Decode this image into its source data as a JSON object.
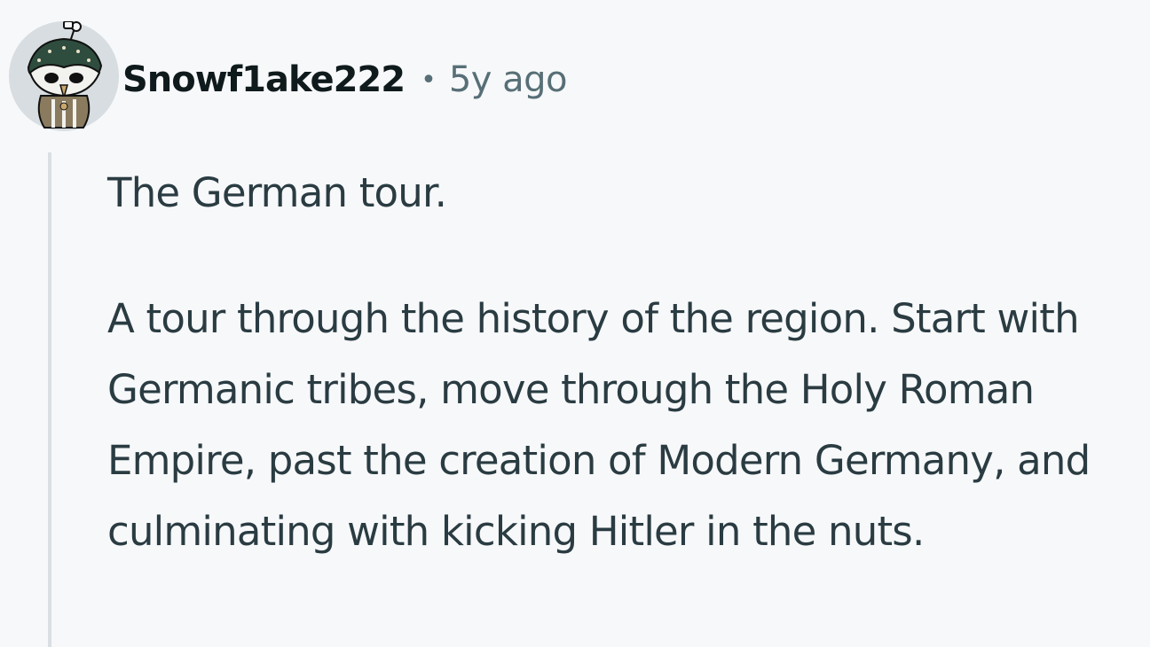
{
  "comment": {
    "author": {
      "username": "Snowf1ake222",
      "separator": "•",
      "timestamp": "5y ago",
      "avatar_icon": "owl-snoo-avatar-icon"
    },
    "paragraphs": [
      "The German tour.",
      "A tour through the history of the region. Start with Germanic tribes, move through the Holy Roman Empire, past the creation of Modern Germany, and culminating with kicking Hitler in the nuts."
    ]
  },
  "colors": {
    "background": "#f7f8fa",
    "username": "#0f1a1c",
    "timestamp": "#576f76",
    "body_text": "#2a3c42",
    "thread_line": "#d9dfe2",
    "avatar_bg": "#d7dde0"
  }
}
